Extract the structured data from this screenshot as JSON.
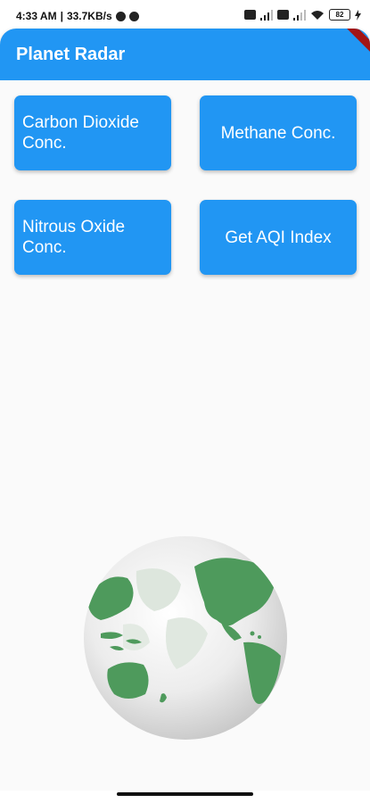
{
  "status_bar": {
    "time": "4:33 AM",
    "separator": "|",
    "net_speed": "33.7KB/s",
    "battery": "82",
    "icons": [
      "whatsapp-icon",
      "app-icon",
      "sim-icon",
      "signal-icon",
      "sim-icon",
      "signal-icon",
      "wifi-icon",
      "battery-icon",
      "charging-icon"
    ]
  },
  "app_bar": {
    "title": "Planet Radar",
    "color": "#2196f3"
  },
  "buttons": {
    "co2": "Carbon Dioxide Conc.",
    "methane": "Methane Conc.",
    "n2o": "Nitrous Oxide Conc.",
    "aqi": "Get AQI Index"
  },
  "globe": {
    "icon": "globe-image",
    "land_color": "#4e9a5c"
  },
  "colors": {
    "accent": "#2196f3",
    "background": "#fafafa"
  }
}
